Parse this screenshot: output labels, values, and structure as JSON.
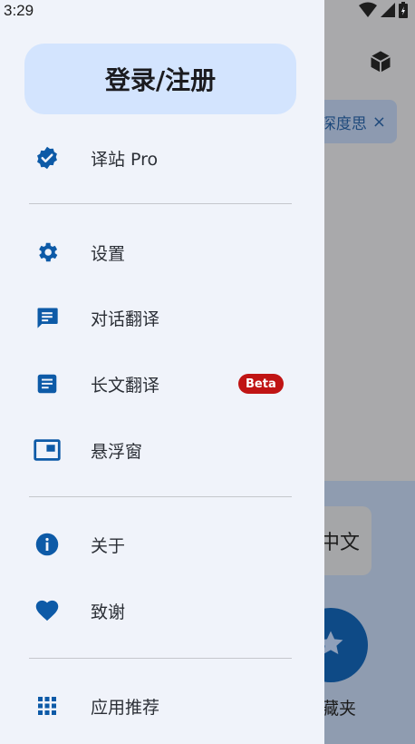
{
  "status_bar": {
    "time": "3:29"
  },
  "background": {
    "chip_text": "深度思",
    "chip_close": "×",
    "lang_text": "中文",
    "fav_label": "藏夹"
  },
  "drawer": {
    "login_label": "登录/注册",
    "accent_color": "#0d5aa7",
    "items": [
      {
        "label": "译站 Pro",
        "icon": "verified-badge-icon"
      },
      {
        "label": "设置",
        "icon": "gear-icon"
      },
      {
        "label": "对话翻译",
        "icon": "chat-icon"
      },
      {
        "label": "长文翻译",
        "icon": "document-icon",
        "badge": "Beta"
      },
      {
        "label": "悬浮窗",
        "icon": "picture-in-picture-icon"
      },
      {
        "label": "关于",
        "icon": "info-icon"
      },
      {
        "label": "致谢",
        "icon": "heart-icon"
      },
      {
        "label": "应用推荐",
        "icon": "apps-grid-icon"
      }
    ]
  }
}
